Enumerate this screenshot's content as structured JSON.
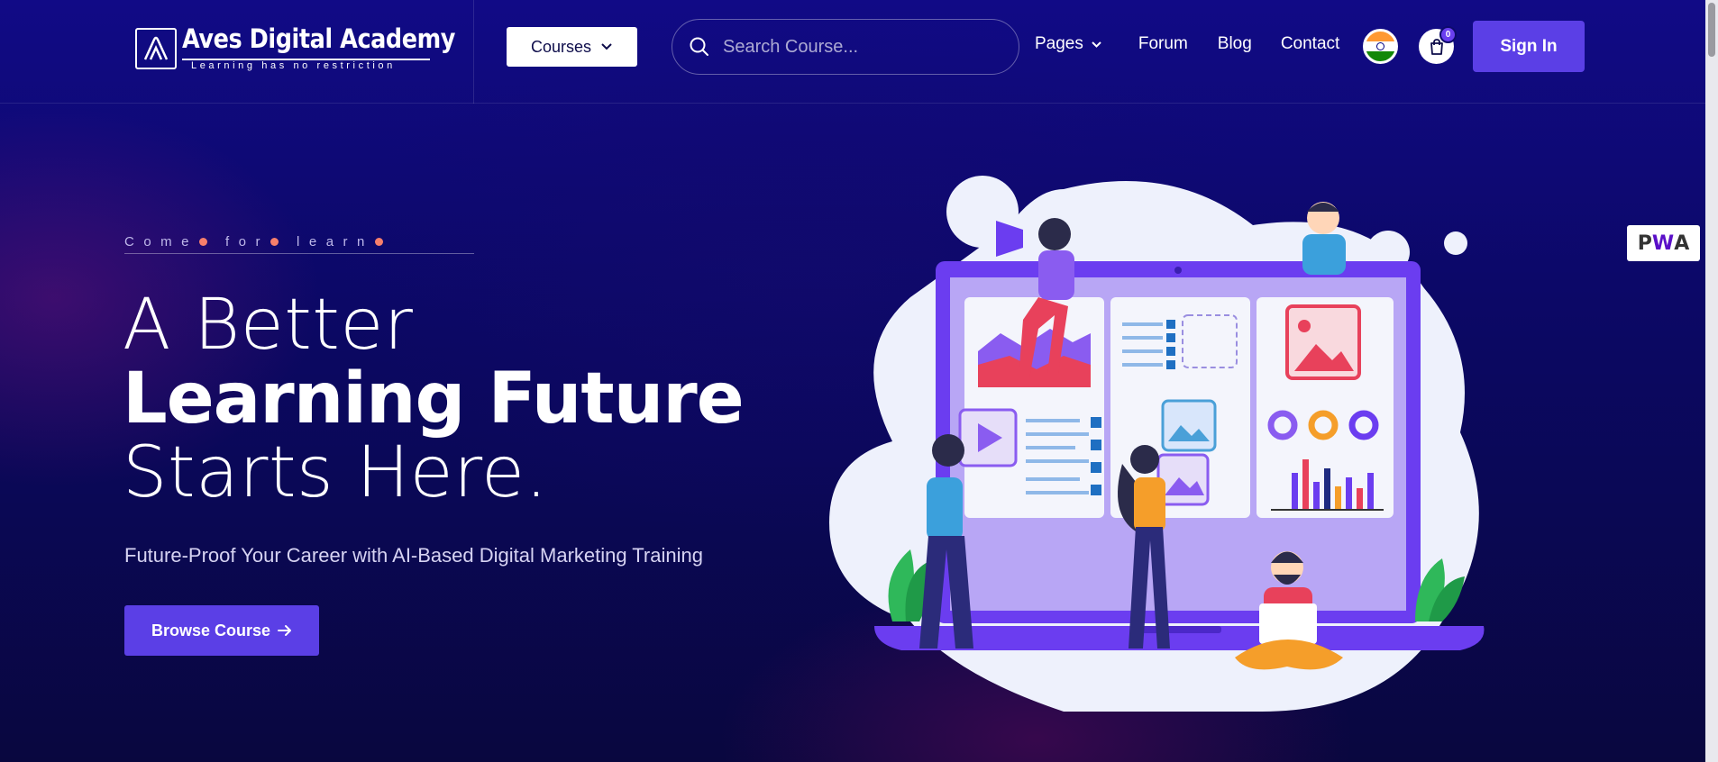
{
  "header": {
    "logo_title": "Aves Digital Academy",
    "logo_tagline": "Learning has no restriction",
    "courses_label": "Courses",
    "search_placeholder": "Search Course...",
    "nav": [
      {
        "label": "Pages",
        "has_dropdown": true
      },
      {
        "label": "Forum"
      },
      {
        "label": "Blog"
      },
      {
        "label": "Contact"
      }
    ],
    "cart_count": "0",
    "signin_label": "Sign In",
    "language_flag_icon": "india-flag-icon"
  },
  "hero": {
    "eyebrow_words": [
      "Come",
      "for",
      "learn"
    ],
    "title_line1": "A Better",
    "title_line2": "Learning Future",
    "title_line3": "Starts Here.",
    "subtitle": "Future-Proof Your Career with AI-Based Digital Marketing Training",
    "cta_label": "Browse Course",
    "cta_icon": "arrow-right-icon"
  },
  "pwa_badge": {
    "p": "P",
    "w": "W",
    "a": "A"
  },
  "colors": {
    "accent": "#5b3fe6",
    "background": "#0b0862",
    "eyebrow_dot": "#f77f6b"
  }
}
